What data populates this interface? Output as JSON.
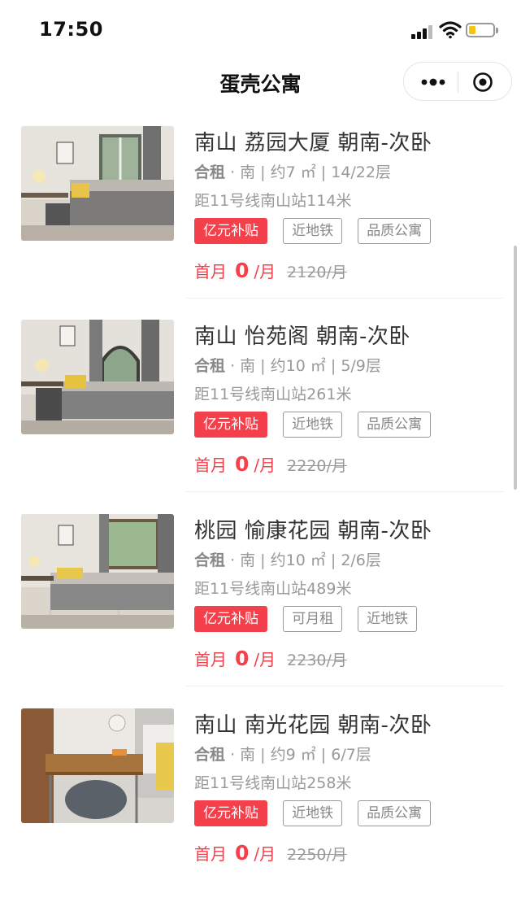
{
  "status_bar": {
    "time": "17:50"
  },
  "nav": {
    "title": "蛋壳公寓"
  },
  "listings": [
    {
      "title": "南山 荔园大厦 朝南-次卧",
      "rent_type": "合租",
      "meta": "· 南 | 约7 ㎡ | 14/22层",
      "distance": "距11号线南山站114米",
      "tags": [
        "亿元补贴",
        "近地铁",
        "品质公寓"
      ],
      "first_month_label": "首月",
      "price": "0",
      "unit": "/月",
      "original_price": "2120/月"
    },
    {
      "title": "南山 怡苑阁 朝南-次卧",
      "rent_type": "合租",
      "meta": "· 南 | 约10 ㎡ | 5/9层",
      "distance": "距11号线南山站261米",
      "tags": [
        "亿元补贴",
        "近地铁",
        "品质公寓"
      ],
      "first_month_label": "首月",
      "price": "0",
      "unit": "/月",
      "original_price": "2220/月"
    },
    {
      "title": "桃园 愉康花园 朝南-次卧",
      "rent_type": "合租",
      "meta": "· 南 | 约10 ㎡ | 2/6层",
      "distance": "距11号线南山站489米",
      "tags": [
        "亿元补贴",
        "可月租",
        "近地铁"
      ],
      "first_month_label": "首月",
      "price": "0",
      "unit": "/月",
      "original_price": "2230/月"
    },
    {
      "title": "南山 南光花园 朝南-次卧",
      "rent_type": "合租",
      "meta": "· 南 | 约9 ㎡ | 6/7层",
      "distance": "距11号线南山站258米",
      "tags": [
        "亿元补贴",
        "近地铁",
        "品质公寓"
      ],
      "first_month_label": "首月",
      "price": "0",
      "unit": "/月",
      "original_price": "2250/月"
    }
  ],
  "colors": {
    "accent": "#f4404b",
    "muted": "#999999",
    "title": "#333333"
  },
  "icons": [
    "signal-icon",
    "wifi-icon",
    "battery-icon",
    "more-icon",
    "close-target-icon"
  ]
}
